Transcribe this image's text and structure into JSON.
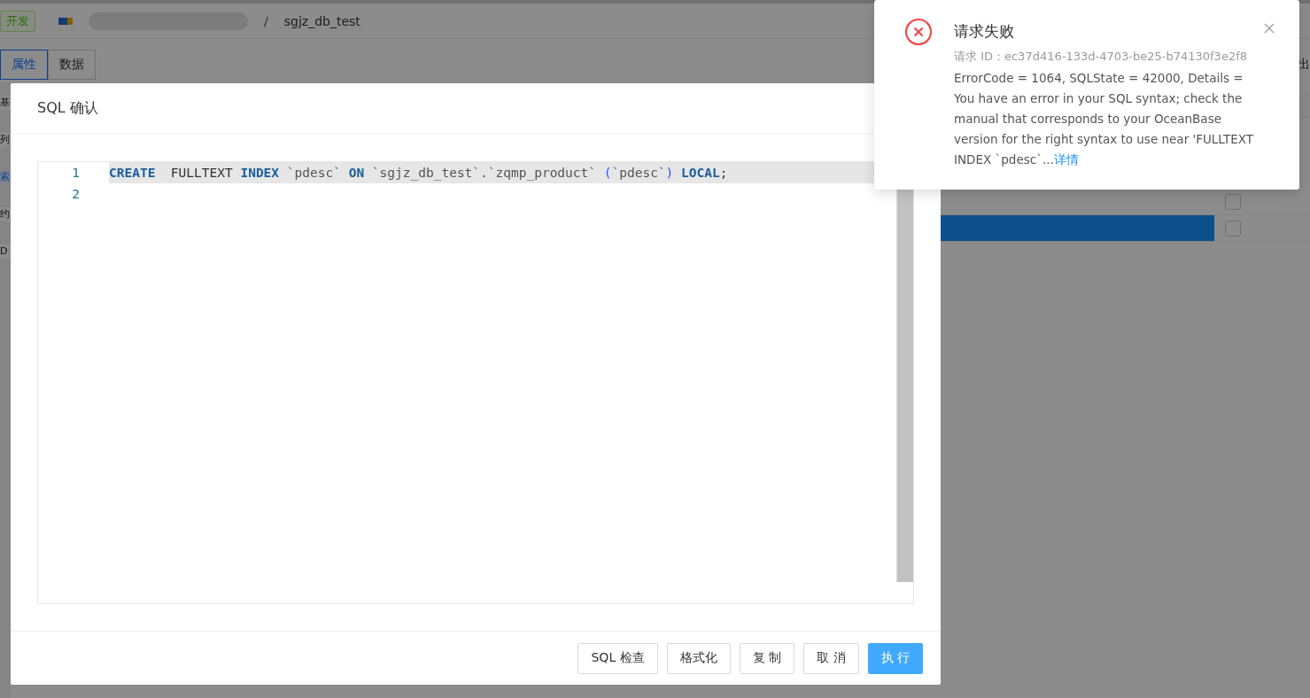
{
  "header": {
    "env_tag": "开发",
    "separator": "/",
    "database": "sgjz_db_test"
  },
  "tabs": [
    {
      "label": "属性",
      "selected": true
    },
    {
      "label": "数据",
      "selected": false
    }
  ],
  "side_items": [
    {
      "label": "基",
      "selected": false
    },
    {
      "label": "列",
      "selected": false
    },
    {
      "label": "索",
      "selected": true
    },
    {
      "label": "约",
      "selected": false
    },
    {
      "label": "D",
      "selected": false
    }
  ],
  "right_action": "出",
  "table": {
    "rows": [
      {
        "selected": false,
        "checked": false
      },
      {
        "selected": true,
        "checked": false
      }
    ]
  },
  "dialog": {
    "title": "SQL 确认",
    "lines": [
      {
        "number": "1",
        "current": true,
        "tokens": [
          {
            "kind": "keyword",
            "text": "CREATE"
          },
          {
            "kind": "plain",
            "text": "  FULLTEXT "
          },
          {
            "kind": "keyword",
            "text": "INDEX"
          },
          {
            "kind": "ident",
            "text": " `pdesc` "
          },
          {
            "kind": "keyword",
            "text": "ON"
          },
          {
            "kind": "ident",
            "text": " `sgjz_db_test`.`zqmp_product` "
          },
          {
            "kind": "paren",
            "text": "("
          },
          {
            "kind": "ident",
            "text": "`pdesc`"
          },
          {
            "kind": "paren",
            "text": ") "
          },
          {
            "kind": "keyword",
            "text": "LOCAL"
          },
          {
            "kind": "plain",
            "text": ";"
          }
        ]
      },
      {
        "number": "2",
        "current": false
      }
    ],
    "buttons": [
      {
        "label": "SQL 检查",
        "primary": false
      },
      {
        "label": "格式化",
        "primary": false
      },
      {
        "label": "复 制",
        "primary": false
      },
      {
        "label": "取 消",
        "primary": false
      },
      {
        "label": "执 行",
        "primary": true
      }
    ]
  },
  "notification": {
    "title": "请求失败",
    "request_id": "请求 ID：ec37d416-133d-4703-be25-b74130f3e2f8",
    "message": "ErrorCode = 1064, SQLState = 42000, Details = You have an error in your SQL syntax; check the manual that corresponds to your OceanBase version for the right syntax to use near 'FULLTEXT INDEX `pdesc`...",
    "link": "详情"
  }
}
